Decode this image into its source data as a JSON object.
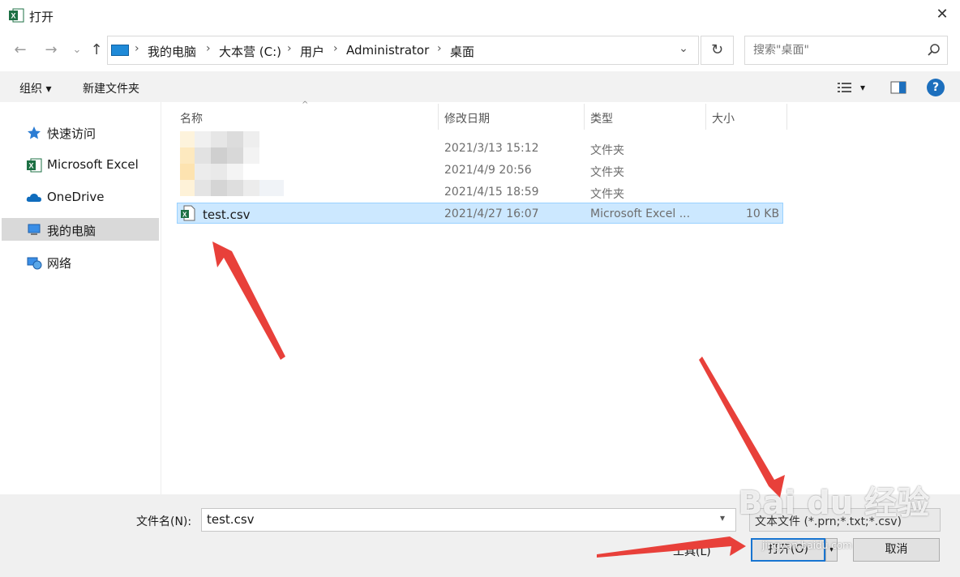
{
  "window": {
    "title": "打开",
    "close_glyph": "✕"
  },
  "nav": {
    "back": "←",
    "forward": "→",
    "history": "⌄",
    "up": "↑"
  },
  "address": {
    "crumbs": [
      "我的电脑",
      "大本营 (C:)",
      "用户",
      "Administrator",
      "桌面"
    ],
    "separator": "›",
    "dropdown": "⌄",
    "refresh": "↻"
  },
  "search": {
    "placeholder": "搜索\"桌面\""
  },
  "toolbar": {
    "organize": "组织 ▾",
    "new_folder": "新建文件夹",
    "view_caret": "▾",
    "help": "?"
  },
  "sidebar": {
    "items": [
      {
        "label": "快速访问",
        "icon": "star-icon"
      },
      {
        "label": "Microsoft Excel",
        "icon": "excel-icon"
      },
      {
        "label": "OneDrive",
        "icon": "cloud-icon"
      },
      {
        "label": "我的电脑",
        "icon": "computer-icon",
        "selected": true
      },
      {
        "label": "网络",
        "icon": "network-icon"
      }
    ]
  },
  "columns": {
    "name": "名称",
    "modified": "修改日期",
    "type": "类型",
    "size": "大小"
  },
  "files": [
    {
      "name": "",
      "modified": "2021/3/13 15:12",
      "type": "文件夹",
      "size": ""
    },
    {
      "name": "",
      "modified": "2021/4/9 20:56",
      "type": "文件夹",
      "size": ""
    },
    {
      "name": "",
      "modified": "2021/4/15 18:59",
      "type": "文件夹",
      "size": ""
    },
    {
      "name": "test.csv",
      "modified": "2021/4/27 16:07",
      "type": "Microsoft Excel ...",
      "size": "10 KB",
      "selected": true
    }
  ],
  "footer": {
    "filename_label": "文件名(N):",
    "filename_value": "test.csv",
    "filetype_value": "文本文件 (*.prn;*.txt;*.csv)",
    "tools": "工具(L)",
    "open": "打开(O)",
    "open_split": "▾",
    "cancel": "取消"
  },
  "watermark": {
    "main": "Bai du 经验",
    "sub": "jingyan.baidu.com"
  },
  "colors": {
    "accent": "#1875d1",
    "selection": "#cce8ff",
    "arrow": "#e8403a",
    "excel": "#1d7044"
  }
}
